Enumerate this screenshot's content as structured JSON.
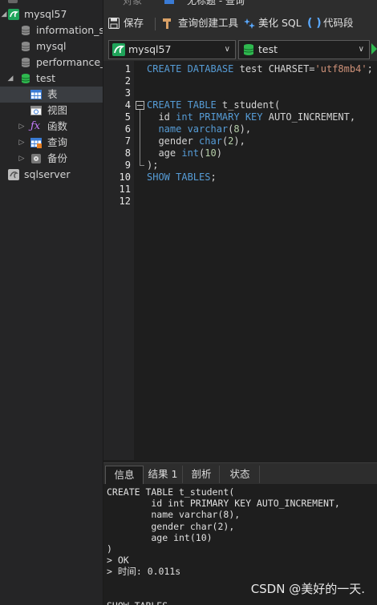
{
  "sidebar": {
    "items": [
      {
        "label": "mysql57"
      },
      {
        "label": "information_sc"
      },
      {
        "label": "mysql"
      },
      {
        "label": "performance_s"
      },
      {
        "label": "test"
      },
      {
        "label": "表"
      },
      {
        "label": "视图"
      },
      {
        "label": "函数"
      },
      {
        "label": "查询"
      },
      {
        "label": "备份"
      },
      {
        "label": "sqlserver"
      }
    ]
  },
  "tabs": [
    {
      "label": "对象"
    },
    {
      "label": "无标题 - 查询"
    }
  ],
  "toolbar": {
    "save_label": "保存",
    "query_builder_label": "查询创建工具",
    "beautify_label": "美化 SQL",
    "snippet_label": "代码段"
  },
  "connection": {
    "selected": "mysql57"
  },
  "database": {
    "selected": "test"
  },
  "editor": {
    "line_numbers": [
      "1",
      "2",
      "3",
      "4",
      "5",
      "6",
      "7",
      "8",
      "9",
      "10",
      "11",
      "12"
    ],
    "lines": [
      [
        {
          "t": "CREATE DATABASE ",
          "c": "kw"
        },
        {
          "t": "test ",
          "c": "txt"
        },
        {
          "t": "CHARSET",
          "c": "txt"
        },
        {
          "t": "=",
          "c": "txt"
        },
        {
          "t": "'utf8mb4'",
          "c": "str"
        },
        {
          "t": ";",
          "c": "txt"
        }
      ],
      [],
      [],
      [
        {
          "t": "CREATE TABLE ",
          "c": "kw"
        },
        {
          "t": "t_student(",
          "c": "txt"
        }
      ],
      [
        {
          "t": "  id ",
          "c": "txt"
        },
        {
          "t": "int PRIMARY KEY ",
          "c": "kw"
        },
        {
          "t": "AUTO_INCREMENT,",
          "c": "txt"
        }
      ],
      [
        {
          "t": "  name ",
          "c": "kw"
        },
        {
          "t": "varchar",
          "c": "kw"
        },
        {
          "t": "(",
          "c": "txt"
        },
        {
          "t": "8",
          "c": "num"
        },
        {
          "t": "),",
          "c": "txt"
        }
      ],
      [
        {
          "t": "  gender ",
          "c": "txt"
        },
        {
          "t": "char",
          "c": "kw"
        },
        {
          "t": "(",
          "c": "txt"
        },
        {
          "t": "2",
          "c": "num"
        },
        {
          "t": "),",
          "c": "txt"
        }
      ],
      [
        {
          "t": "  age ",
          "c": "txt"
        },
        {
          "t": "int",
          "c": "kw"
        },
        {
          "t": "(",
          "c": "txt"
        },
        {
          "t": "10",
          "c": "num"
        },
        {
          "t": ")",
          "c": "txt"
        }
      ],
      [
        {
          "t": ");",
          "c": "txt"
        }
      ],
      [
        {
          "t": "SHOW TABLES",
          "c": "kw"
        },
        {
          "t": ";",
          "c": "txt"
        }
      ],
      [],
      []
    ]
  },
  "results": {
    "tabs": [
      {
        "label": "信息"
      },
      {
        "label": "结果 1"
      },
      {
        "label": "剖析"
      },
      {
        "label": "状态"
      }
    ],
    "lines": [
      "CREATE TABLE t_student(",
      "        id int PRIMARY KEY AUTO_INCREMENT,",
      "        name varchar(8),",
      "        gender char(2),",
      "        age int(10)",
      ")",
      "> OK",
      "> 时间: 0.011s",
      "",
      "",
      "SHOW TABLES"
    ]
  },
  "watermark": "CSDN @美好的一天.",
  "colors": {
    "keyword": "#569cd6",
    "string": "#ce9178",
    "number": "#b5cea8",
    "mysql_green": "#1fa45a"
  }
}
